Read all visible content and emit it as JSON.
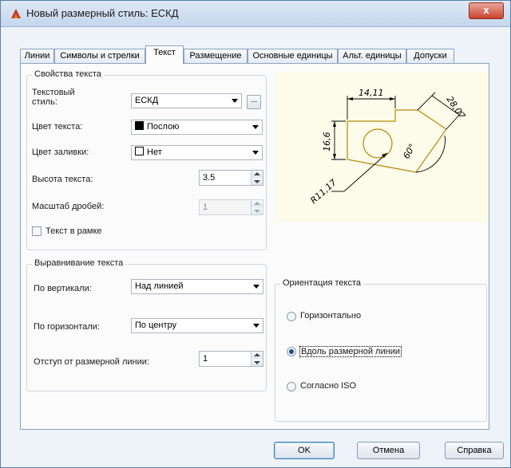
{
  "window": {
    "title": "Новый размерный стиль: ЕСКД",
    "close_label": "x"
  },
  "tabs": [
    {
      "label": "Линии",
      "active": false
    },
    {
      "label": "Символы и стрелки",
      "active": false
    },
    {
      "label": "Текст",
      "active": true
    },
    {
      "label": "Размещение",
      "active": false
    },
    {
      "label": "Основные единицы",
      "active": false
    },
    {
      "label": "Альт. единицы",
      "active": false
    },
    {
      "label": "Допуски",
      "active": false
    }
  ],
  "text_props": {
    "group_title": "Свойства текста",
    "style_label_1": "Текстовый",
    "style_label_2": "стиль:",
    "style_value": "ЕСКД",
    "style_browse": "...",
    "color_label": "Цвет текста:",
    "color_value": "Послою",
    "fill_label": "Цвет заливки:",
    "fill_value": "Нет",
    "height_label": "Высота текста:",
    "height_value": "3.5",
    "scale_label": "Масштаб дробей:",
    "scale_value": "1",
    "frame_label": "Текст в рамке",
    "frame_checked": false
  },
  "alignment": {
    "group_title": "Выравнивание текста",
    "vertical_label": "По вертикали:",
    "vertical_value": "Над линией",
    "horizontal_label": "По горизонтали:",
    "horizontal_value": "По центру",
    "offset_label": "Отступ от размерной линии:",
    "offset_value": "1"
  },
  "orientation": {
    "group_title": "Ориентация текста",
    "options": [
      {
        "label": "Горизонтально",
        "selected": false
      },
      {
        "label": "Вдоль размерной линии",
        "selected": true
      },
      {
        "label": "Согласно ISO",
        "selected": false
      }
    ]
  },
  "preview": {
    "dim_top": "14,11",
    "dim_left": "16,6",
    "dim_right": "28,07",
    "angle": "60°",
    "radius": "R11,17",
    "line_color": "#b8860b"
  },
  "buttons": {
    "ok": "OK",
    "cancel": "Отмена",
    "help": "Справка"
  },
  "colors": {
    "accent": "#1f4e8c",
    "preview_bg": "#fdfbe9"
  }
}
